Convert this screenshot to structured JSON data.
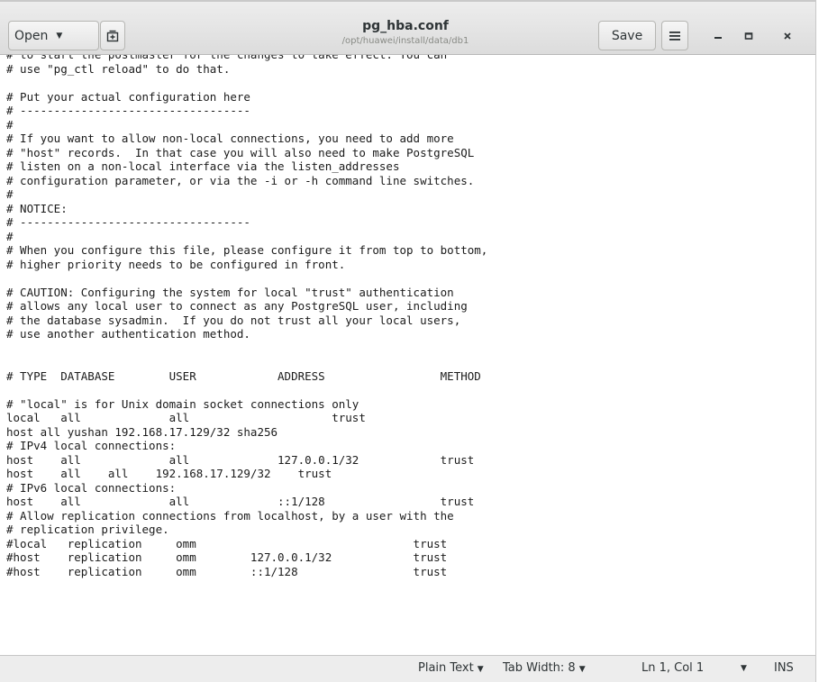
{
  "header": {
    "open_label": "Open",
    "title": "pg_hba.conf",
    "subtitle": "/opt/huawei/install/data/db1",
    "save_label": "Save"
  },
  "icons": {
    "open_dropdown": "chevron-down-icon",
    "new_tab": "new-tab-icon",
    "menu": "hamburger-menu-icon",
    "minimize": "minimize-icon",
    "maximize": "maximize-icon",
    "close": "close-icon"
  },
  "editor": {
    "lines": [
      "# to start the postmaster for the changes to take effect. You can",
      "# use \"pg_ctl reload\" to do that.",
      "",
      "# Put your actual configuration here",
      "# ----------------------------------",
      "#",
      "# If you want to allow non-local connections, you need to add more",
      "# \"host\" records.  In that case you will also need to make PostgreSQL",
      "# listen on a non-local interface via the listen_addresses",
      "# configuration parameter, or via the -i or -h command line switches.",
      "#",
      "# NOTICE:",
      "# ----------------------------------",
      "#",
      "# When you configure this file, please configure it from top to bottom,",
      "# higher priority needs to be configured in front.",
      "",
      "# CAUTION: Configuring the system for local \"trust\" authentication",
      "# allows any local user to connect as any PostgreSQL user, including",
      "# the database sysadmin.  If you do not trust all your local users,",
      "# use another authentication method.",
      "",
      "",
      "# TYPE  DATABASE        USER            ADDRESS                 METHOD",
      "",
      "# \"local\" is for Unix domain socket connections only",
      "local   all             all                     trust",
      "host all yushan 192.168.17.129/32 sha256",
      "# IPv4 local connections:",
      "host    all             all             127.0.0.1/32            trust",
      "host    all    all    192.168.17.129/32    trust",
      "# IPv6 local connections:",
      "host    all             all             ::1/128                 trust",
      "# Allow replication connections from localhost, by a user with the",
      "# replication privilege.",
      "#local   replication     omm                                trust",
      "#host    replication     omm        127.0.0.1/32            trust",
      "#host    replication     omm        ::1/128                 trust"
    ]
  },
  "statusbar": {
    "language": "Plain Text",
    "tab_width": "Tab Width: 8",
    "position": "Ln 1, Col 1",
    "insert_mode": "INS"
  }
}
